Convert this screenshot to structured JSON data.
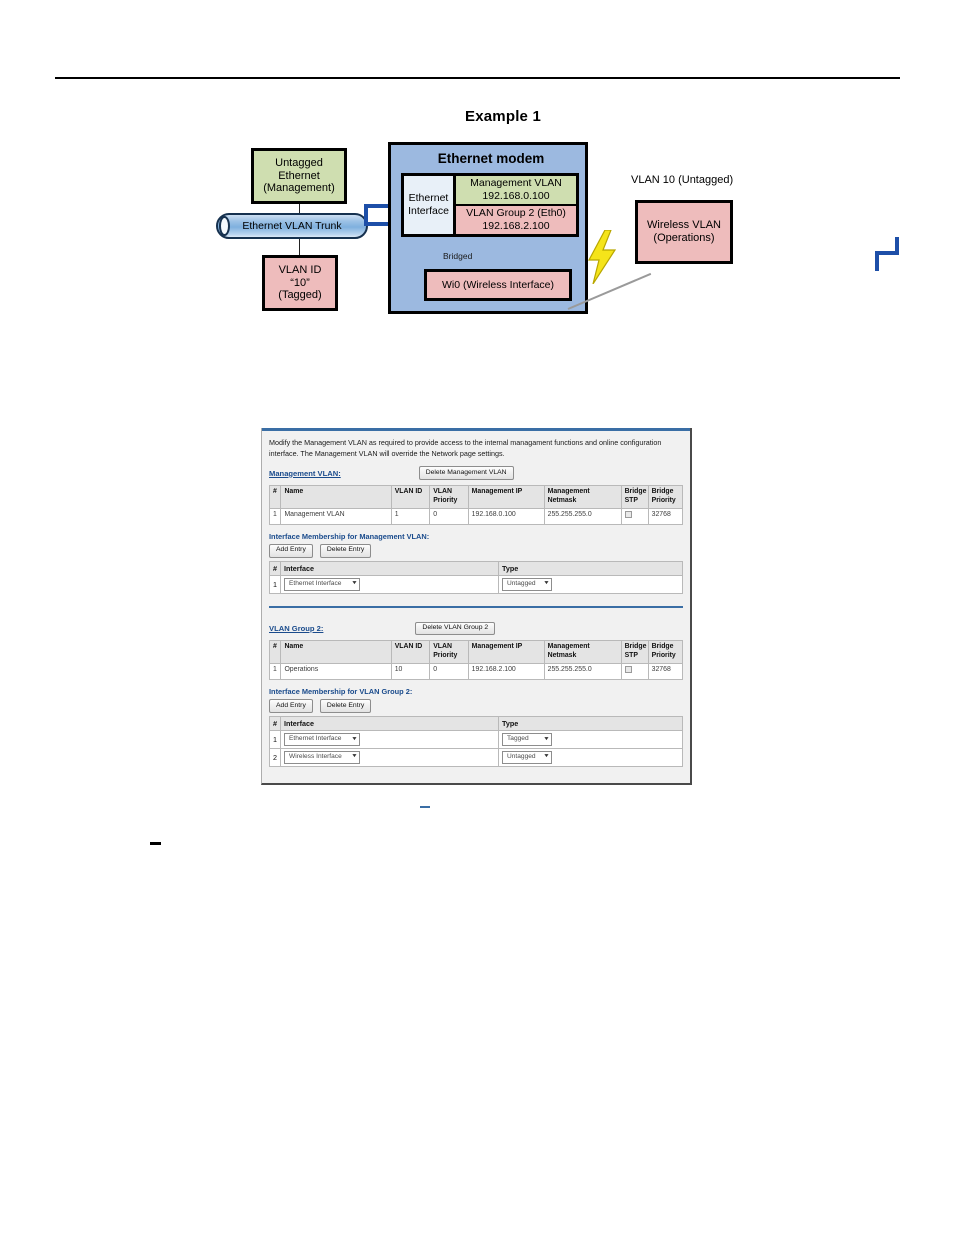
{
  "page": {
    "header_rule": true,
    "stray_marks": [
      "blue-dash",
      "black-dash"
    ]
  },
  "diagram": {
    "title": "Example 1",
    "untagged_box": "Untagged\nEthernet\n(Management)",
    "untagged_line1": "Untagged",
    "untagged_line2": "Ethernet",
    "untagged_line3": "(Management)",
    "trunk_label": "Ethernet VLAN Trunk",
    "vlanid_line1": "VLAN ID",
    "vlanid_line2": "“10”",
    "vlanid_line3": "(Tagged)",
    "modem_title": "Ethernet modem",
    "eth_iface_line1": "Ethernet",
    "eth_iface_line2": "Interface",
    "mgmt_vlan_line1": "Management VLAN",
    "mgmt_vlan_line2": "192.168.0.100",
    "group2_line1": "VLAN Group 2 (Eth0)",
    "group2_line2": "192.168.2.100",
    "bridged_label": "Bridged",
    "wi0_label": "Wi0 (Wireless Interface)",
    "vlan10_label": "VLAN 10 (Untagged)",
    "wireless_line1": "Wireless VLAN",
    "wireless_line2": "(Operations)",
    "colors": {
      "green_box": "#cfdeb0",
      "pink_box": "#eebcbc",
      "modem_bg": "#9cb9e0",
      "trunk_blue": "#9dc2e6",
      "connector_blue": "#1d4fa8",
      "bolt_yellow": "#f5e41a"
    }
  },
  "panel": {
    "intro": "Modify the Management VLAN as required to provide access to the internal managament functions and online configuration interface. The Management VLAN will override the Network page settings.",
    "mgmt_section": {
      "link_label": "Management VLAN:",
      "delete_button": "Delete Management VLAN",
      "table_headers": [
        "#",
        "Name",
        "VLAN ID",
        "VLAN Priority",
        "Management IP",
        "Management Netmask",
        "Bridge STP",
        "Bridge Priority"
      ],
      "rows": [
        {
          "num": "1",
          "name": "Management VLAN",
          "vlan_id": "1",
          "vlan_priority": "0",
          "management_ip": "192.168.0.100",
          "management_netmask": "255.255.255.0",
          "bridge_stp_checked": false,
          "bridge_priority": "32768"
        }
      ],
      "membership_title": "Interface Membership for Management VLAN:",
      "add_button": "Add Entry",
      "delete_button_entry": "Delete Entry",
      "membership_headers": [
        "#",
        "Interface",
        "Type"
      ],
      "membership_rows": [
        {
          "num": "1",
          "interface": "Ethernet Interface",
          "type": "Untagged"
        }
      ]
    },
    "group2_section": {
      "link_label": "VLAN Group 2:",
      "delete_button": "Delete VLAN Group 2",
      "table_headers": [
        "#",
        "Name",
        "VLAN ID",
        "VLAN Priority",
        "Management IP",
        "Management Netmask",
        "Bridge STP",
        "Bridge Priority"
      ],
      "rows": [
        {
          "num": "1",
          "name": "Operations",
          "vlan_id": "10",
          "vlan_priority": "0",
          "management_ip": "192.168.2.100",
          "management_netmask": "255.255.255.0",
          "bridge_stp_checked": false,
          "bridge_priority": "32768"
        }
      ],
      "membership_title": "Interface Membership for VLAN Group 2:",
      "add_button": "Add Entry",
      "delete_button_entry": "Delete Entry",
      "membership_headers": [
        "#",
        "Interface",
        "Type"
      ],
      "membership_rows": [
        {
          "num": "1",
          "interface": "Ethernet Interface",
          "type": "Tagged"
        },
        {
          "num": "2",
          "interface": "Wireless Interface",
          "type": "Untagged"
        }
      ]
    },
    "accent_color": "#3a6ea5",
    "link_color": "#1a4b8c"
  }
}
